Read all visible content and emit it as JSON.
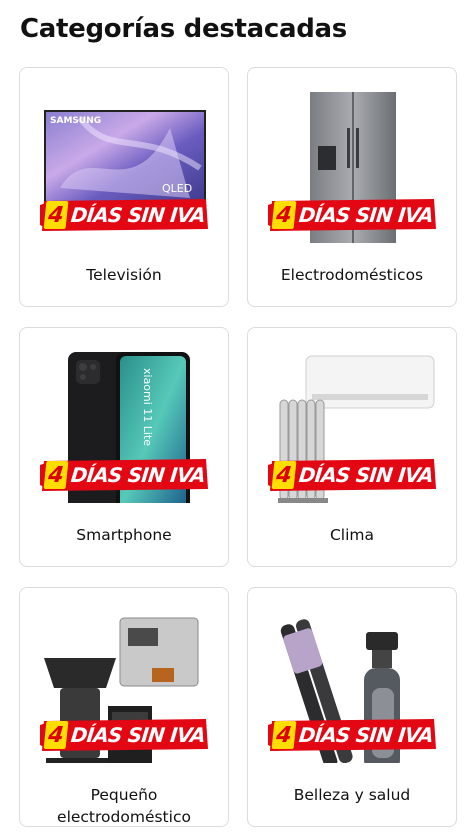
{
  "page": {
    "title": "Categorías destacadas"
  },
  "badge": {
    "number": "4",
    "text": "DÍAS SIN IVA"
  },
  "categories": [
    {
      "label": "Televisión",
      "icon": "tv-image",
      "brand_text": "SAMSUNG",
      "model_text": "QLED"
    },
    {
      "label": "Electrodomésticos",
      "icon": "fridge-image",
      "brand_text": ""
    },
    {
      "label": "Smartphone",
      "icon": "smartphone-image",
      "brand_text": "xiaomi 11 Lite"
    },
    {
      "label": "Clima",
      "icon": "air-conditioner-image",
      "brand_text": ""
    },
    {
      "label": "Pequeño electrodoméstico",
      "icon": "small-appliance-image",
      "brand_text": ""
    },
    {
      "label": "Belleza y salud",
      "icon": "beauty-image",
      "brand_text": ""
    }
  ],
  "colors": {
    "badge_red": "#e30613",
    "badge_yellow": "#ffdd00",
    "card_border": "#dcdcdc"
  }
}
